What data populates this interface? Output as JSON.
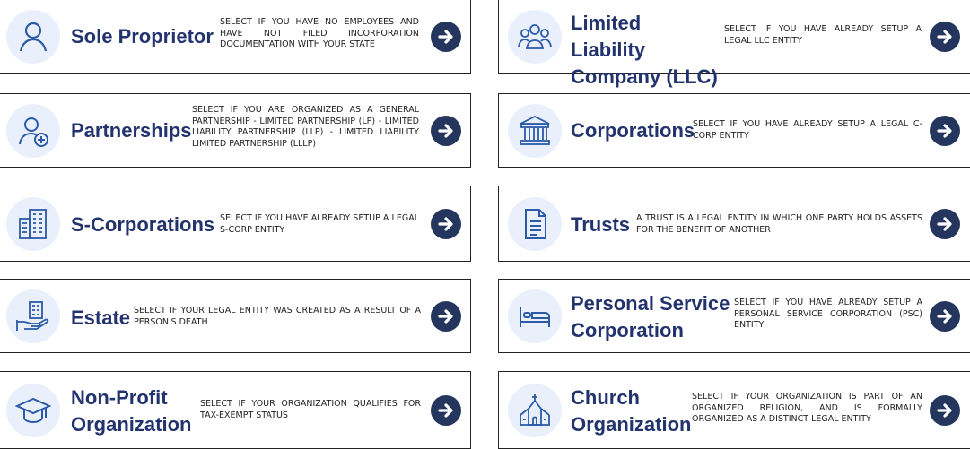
{
  "colors": {
    "accent": "#2b5aa8",
    "title": "#22336e",
    "arrow_bg": "#24365e",
    "icon_bg": "#e9f0fb"
  },
  "cards": [
    {
      "title": "Sole Proprietor",
      "desc": "SELECT IF YOU HAVE NO EMPLOYEES AND HAVE NOT FILED INCORPORATION DOCUMENTATION WITH YOUR STATE",
      "icon": "person-icon"
    },
    {
      "title": "Limited Liability Company (LLC)",
      "desc": "SELECT IF YOU HAVE ALREADY SETUP A LEGAL LLC ENTITY",
      "icon": "group-icon"
    },
    {
      "title": "Partnerships",
      "desc": "SELECT IF YOU ARE ORGANIZED AS A GENERAL PARTNERSHIP - LIMITED PARTNERSHIP (LP) - LIMITED LIABILITY PARTNERSHIP (LLP) - LIMITED LIABILITY LIMITED PARTNERSHIP (LLLP)",
      "icon": "add-person-icon"
    },
    {
      "title": "Corporations",
      "desc": "SELECT IF YOU HAVE ALREADY SETUP A LEGAL C-CORP ENTITY",
      "icon": "bank-icon"
    },
    {
      "title": "S-Corporations",
      "desc": "SELECT IF YOU HAVE ALREADY SETUP A LEGAL S-CORP ENTITY",
      "icon": "office-building-icon"
    },
    {
      "title": "Trusts",
      "desc": "A TRUST IS A LEGAL ENTITY IN WHICH ONE PARTY HOLDS ASSETS FOR THE BENEFIT OF ANOTHER",
      "icon": "document-icon"
    },
    {
      "title": "Estate",
      "desc": "SELECT IF YOUR LEGAL ENTITY WAS CREATED AS A RESULT OF A PERSON'S DEATH",
      "icon": "estate-hand-icon"
    },
    {
      "title": "Personal Service Corporation",
      "desc": "SELECT IF YOU HAVE ALREADY SETUP A PERSONAL SERVICE CORPORATION (PSC) ENTITY",
      "icon": "bed-icon"
    },
    {
      "title": "Non-Profit Organization",
      "desc": "SELECT IF YOUR ORGANIZATION QUALIFIES FOR TAX-EXEMPT STATUS",
      "icon": "graduation-cap-icon"
    },
    {
      "title": "Church Organization",
      "desc": "SELECT IF YOUR ORGANIZATION IS PART OF AN ORGANIZED RELIGION, AND IS FORMALLY ORGANIZED AS A DISTINCT LEGAL ENTITY",
      "icon": "church-icon"
    }
  ]
}
